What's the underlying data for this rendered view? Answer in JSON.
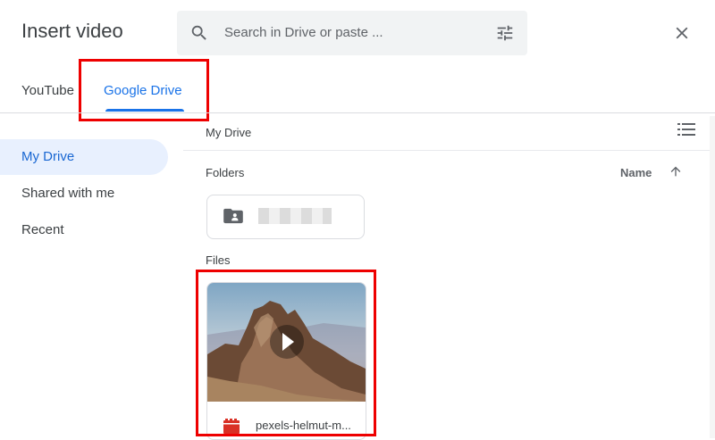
{
  "dialog": {
    "title": "Insert video"
  },
  "search": {
    "placeholder": "Search in Drive or paste ..."
  },
  "tabs": [
    {
      "label": "YouTube"
    },
    {
      "label": "Google Drive"
    }
  ],
  "sidebar": {
    "items": [
      {
        "label": "My Drive"
      },
      {
        "label": "Shared with me"
      },
      {
        "label": "Recent"
      }
    ]
  },
  "content": {
    "breadcrumb": "My Drive",
    "folders_label": "Folders",
    "sort_label": "Name",
    "files_label": "Files",
    "file": {
      "name": "pexels-helmut-m..."
    }
  },
  "colors": {
    "accent": "#1a73e8",
    "highlight": "#e00000"
  }
}
